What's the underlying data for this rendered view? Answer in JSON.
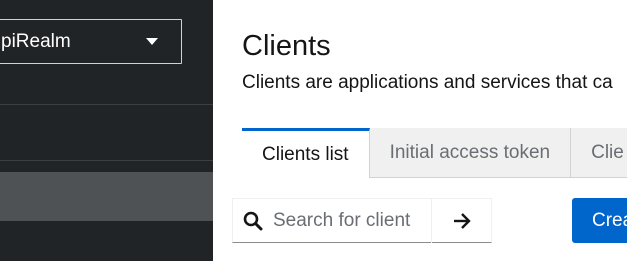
{
  "sidebar": {
    "realm_selector": {
      "value": "piRealm"
    }
  },
  "header": {
    "title": "Clients",
    "description": "Clients are applications and services that ca"
  },
  "tabs": [
    {
      "label": "Clients list",
      "active": true
    },
    {
      "label": "Initial access token",
      "active": false
    },
    {
      "label": "Clie",
      "active": false
    }
  ],
  "toolbar": {
    "search_placeholder": "Search for client",
    "create_label": "Crea"
  },
  "colors": {
    "sidebar_bg": "#212427",
    "sidebar_selected": "#4f5255",
    "accent": "#0066cc"
  },
  "icons": {
    "search": "search-icon",
    "submit": "arrow-right-icon",
    "caret": "caret-down-icon"
  }
}
